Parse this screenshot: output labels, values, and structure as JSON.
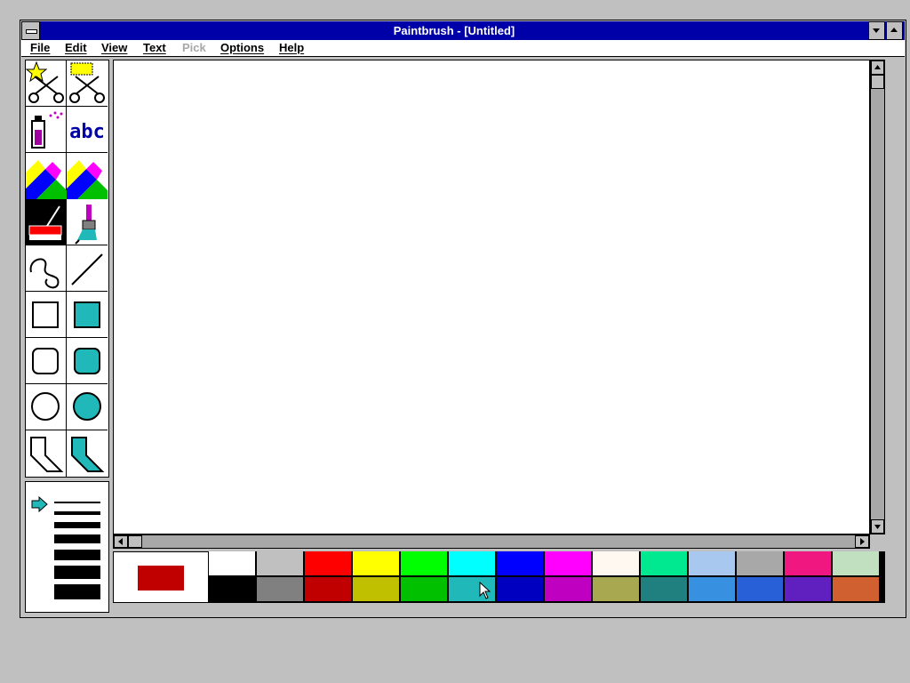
{
  "title": "Paintbrush - [Untitled]",
  "menu": {
    "file": "File",
    "edit": "Edit",
    "view": "View",
    "text": "Text",
    "pick": "Pick",
    "options": "Options",
    "help": "Help"
  },
  "tools": {
    "text_tool_label": "abc"
  },
  "colors": {
    "title_bar": "#0000a8",
    "foreground": "#c00000",
    "background": "#ffffff"
  },
  "palette": {
    "top_row": [
      "#ffffff",
      "#c0c0c0",
      "#ff0000",
      "#ffff00",
      "#00ff00",
      "#00ffff",
      "#0000ff",
      "#ff00ff",
      "#fff8f0",
      "#00e890",
      "#a8c8f0",
      "#a8a8a8",
      "#f01880",
      "#c0e0c0"
    ],
    "bottom_row": [
      "#000000",
      "#808080",
      "#c00000",
      "#c0c000",
      "#00c000",
      "#20b8b8",
      "#0000c0",
      "#c000c0",
      "#a8a850",
      "#208080",
      "#3890e0",
      "#2860d8",
      "#6020c0",
      "#d06030"
    ]
  },
  "icons": {
    "system_menu": "system-menu-icon",
    "minimize": "minimize-arrow-icon",
    "maximize": "maximize-arrow-icon",
    "scroll_up": "scroll-up-arrow-icon",
    "scroll_down": "scroll-down-arrow-icon",
    "scroll_left": "scroll-left-arrow-icon",
    "scroll_right": "scroll-right-arrow-icon",
    "line_width_pointer": "arrow-right-icon",
    "cursor": "mouse-pointer-icon"
  }
}
